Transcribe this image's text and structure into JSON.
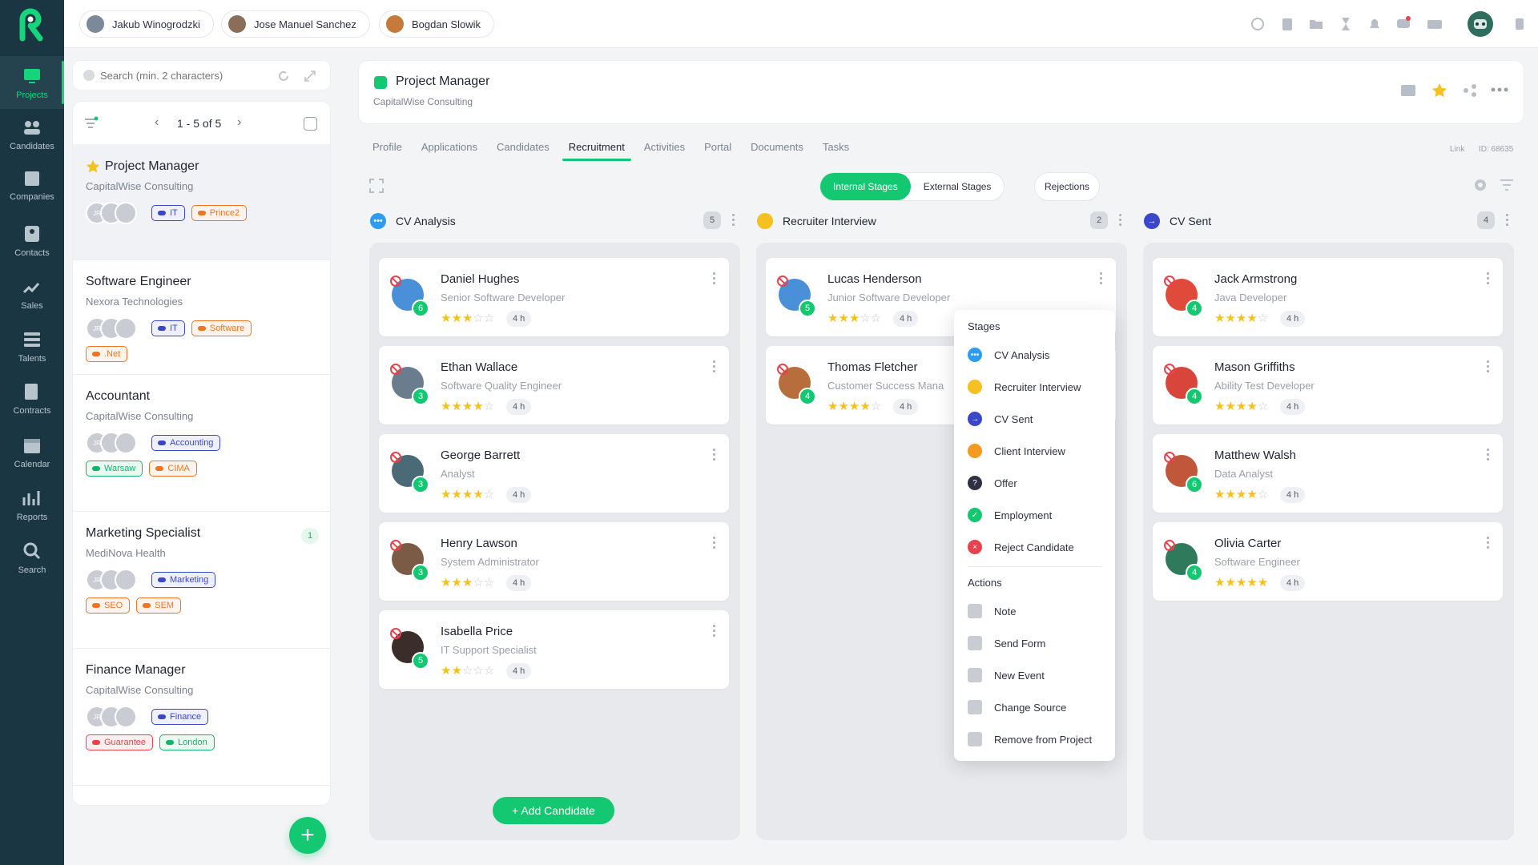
{
  "colors": {
    "accent": "#14c872",
    "sidebar": "#193642",
    "blue": "#3a47c9",
    "orange": "#f07522",
    "red": "#e8424d"
  },
  "sidebar": [
    {
      "label": "Projects",
      "icon": "monitor-icon"
    },
    {
      "label": "Candidates",
      "icon": "people-icon"
    },
    {
      "label": "Companies",
      "icon": "building-icon"
    },
    {
      "label": "Contacts",
      "icon": "contact-card-icon"
    },
    {
      "label": "Sales",
      "icon": "sales-chart-icon"
    },
    {
      "label": "Talents",
      "icon": "list-icon"
    },
    {
      "label": "Contracts",
      "icon": "contract-pen-icon"
    },
    {
      "label": "Calendar",
      "icon": "calendar-icon"
    },
    {
      "label": "Reports",
      "icon": "reports-icon"
    },
    {
      "label": "Search",
      "icon": "search-icon"
    }
  ],
  "topbar": {
    "users": [
      "Jakub Winogrodzki",
      "Jose Manuel Sanchez",
      "Bogdan Slowik"
    ]
  },
  "search": {
    "placeholder": "Search (min. 2 characters)"
  },
  "list": {
    "pagination": "1 - 5 of 5",
    "projects": [
      {
        "title": "Project Manager",
        "company": "CapitalWise Consulting",
        "starred": true,
        "tags": [
          [
            "IT",
            "blue"
          ],
          [
            "Prince2",
            "orange"
          ]
        ],
        "tags2": [],
        "badge": ""
      },
      {
        "title": "Software Engineer",
        "company": "Nexora Technologies",
        "starred": false,
        "tags": [
          [
            "IT",
            "blue"
          ],
          [
            "Software",
            "orange"
          ]
        ],
        "tags2": [
          [
            ".Net",
            "orange"
          ]
        ],
        "badge": ""
      },
      {
        "title": "Accountant",
        "company": "CapitalWise Consulting",
        "starred": false,
        "tags": [
          [
            "Accounting",
            "blue"
          ]
        ],
        "tags2": [
          [
            "Warsaw",
            "green"
          ],
          [
            "CIMA",
            "orange"
          ]
        ],
        "badge": ""
      },
      {
        "title": "Marketing Specialist",
        "company": "MediNova Health",
        "starred": false,
        "tags": [
          [
            "Marketing",
            "blue"
          ]
        ],
        "tags2": [
          [
            "SEO",
            "orange"
          ],
          [
            "SEM",
            "orange"
          ]
        ],
        "badge": "1"
      },
      {
        "title": "Finance Manager",
        "company": "CapitalWise Consulting",
        "starred": false,
        "tags": [
          [
            "Finance",
            "blue"
          ]
        ],
        "tags2": [
          [
            "Guarantee",
            "red"
          ],
          [
            "London",
            "green"
          ]
        ],
        "badge": ""
      }
    ]
  },
  "header": {
    "title": "Project Manager",
    "company": "CapitalWise Consulting",
    "link": "Link",
    "id": "ID: 68635"
  },
  "tabs": [
    "Profile",
    "Applications",
    "Candidates",
    "Recruitment",
    "Activities",
    "Portal",
    "Documents",
    "Tasks"
  ],
  "stage_toggle": {
    "internal": "Internal Stages",
    "external": "External Stages",
    "rejections": "Rejections"
  },
  "columns": [
    {
      "name": "CV Analysis",
      "count": "5",
      "color": "#2e9cf0",
      "glyph": "•••",
      "cards": [
        {
          "name": "Daniel Hughes",
          "role": "Senior Software Developer",
          "stars": 3,
          "num": "6",
          "hours": "4 h",
          "av": "#4a90d9"
        },
        {
          "name": "Ethan Wallace",
          "role": "Software Quality Engineer",
          "stars": 4,
          "num": "3",
          "hours": "4 h",
          "av": "#6a7c8e"
        },
        {
          "name": "George Barrett",
          "role": "Analyst",
          "stars": 4,
          "num": "3",
          "hours": "4 h",
          "av": "#4a6a78"
        },
        {
          "name": "Henry Lawson",
          "role": "System Administrator",
          "stars": 3,
          "num": "3",
          "hours": "4 h",
          "av": "#7b5b45"
        },
        {
          "name": "Isabella Price",
          "role": "IT Support Specialist",
          "stars": 2,
          "num": "5",
          "hours": "4 h",
          "av": "#3b2e2a"
        }
      ]
    },
    {
      "name": "Recruiter Interview",
      "count": "2",
      "color": "#f5c120",
      "glyph": "",
      "cards": [
        {
          "name": "Lucas Henderson",
          "role": "Junior Software Developer",
          "stars": 3,
          "num": "5",
          "hours": "4 h",
          "av": "#4a90d9"
        },
        {
          "name": "Thomas Fletcher",
          "role": "Customer Success Mana",
          "stars": 4,
          "num": "4",
          "hours": "4 h",
          "av": "#b76d3c"
        }
      ]
    },
    {
      "name": "CV Sent",
      "count": "4",
      "color": "#3a47c9",
      "glyph": "→",
      "cards": [
        {
          "name": "Jack Armstrong",
          "role": "Java Developer",
          "stars": 4,
          "num": "4",
          "hours": "4 h",
          "av": "#e04a3a"
        },
        {
          "name": "Mason Griffiths",
          "role": "Ability Test Developer",
          "stars": 4,
          "num": "4",
          "hours": "4 h",
          "av": "#d8453a"
        },
        {
          "name": "Matthew Walsh",
          "role": "Data Analyst",
          "stars": 4,
          "num": "6",
          "hours": "4 h",
          "av": "#c0563a"
        },
        {
          "name": "Olivia Carter",
          "role": "Software Engineer",
          "stars": 5,
          "num": "4",
          "hours": "4 h",
          "av": "#2f7a5a"
        }
      ]
    }
  ],
  "add_candidate": "+ Add Candidate",
  "menu": {
    "stages_heading": "Stages",
    "stages": [
      {
        "label": "CV Analysis",
        "color": "#2e9cf0",
        "glyph": "•••"
      },
      {
        "label": "Recruiter Interview",
        "color": "#f5c120",
        "glyph": ""
      },
      {
        "label": "CV Sent",
        "color": "#3a47c9",
        "glyph": "→"
      },
      {
        "label": "Client Interview",
        "color": "#f59a20",
        "glyph": ""
      },
      {
        "label": "Offer",
        "color": "#2d3142",
        "glyph": "?"
      },
      {
        "label": "Employment",
        "color": "#14c872",
        "glyph": "✓"
      },
      {
        "label": "Reject Candidate",
        "color": "#e8424d",
        "glyph": "×"
      }
    ],
    "actions_heading": "Actions",
    "actions": [
      "Note",
      "Send Form",
      "New Event",
      "Change Source",
      "Remove from Project"
    ]
  }
}
